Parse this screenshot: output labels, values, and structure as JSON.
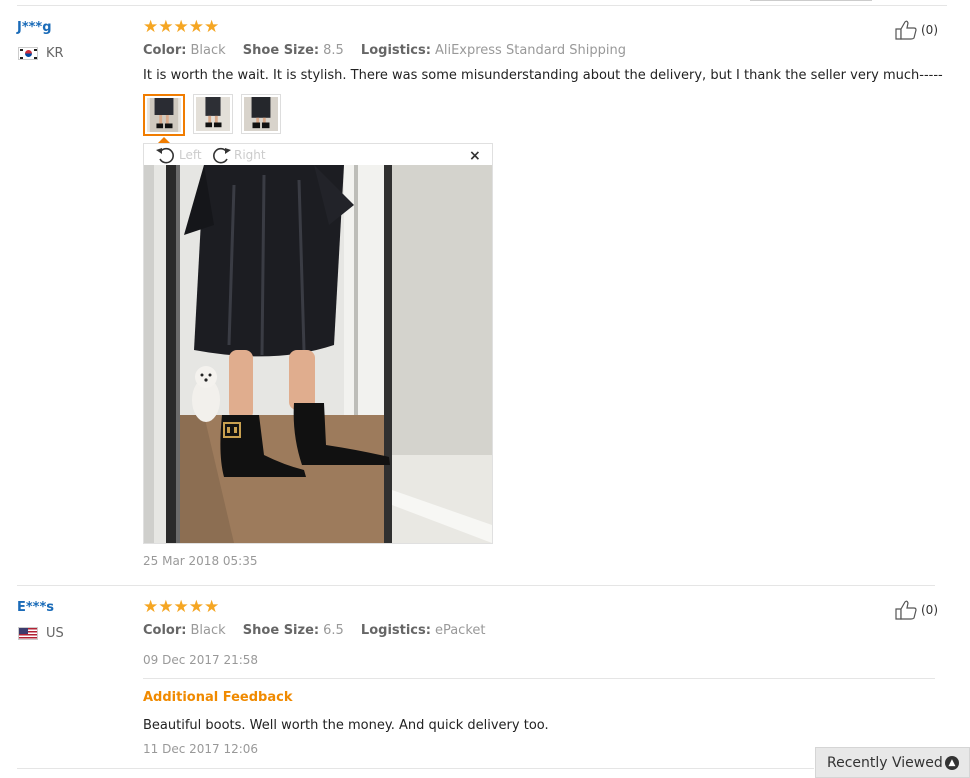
{
  "reviews": [
    {
      "user": "J***g",
      "country": "KR",
      "stars": "★★★★★",
      "rating": 5,
      "attributes": [
        {
          "label": "Color:",
          "value": "Black"
        },
        {
          "label": "Shoe Size:",
          "value": "8.5"
        },
        {
          "label": "Logistics:",
          "value": "AliExpress Standard Shipping"
        }
      ],
      "text": "It is worth the wait. It is stylish. There was some misunderstanding about the delivery, but I thank the seller very much-----",
      "helpful_count": "(0)",
      "viewer": {
        "rotate_left": "Left",
        "rotate_right": "Right",
        "close": "×"
      },
      "date": "25 Mar 2018 05:35"
    },
    {
      "user": "E***s",
      "country": "US",
      "stars": "★★★★★",
      "rating": 5,
      "attributes": [
        {
          "label": "Color:",
          "value": "Black"
        },
        {
          "label": "Shoe Size:",
          "value": "6.5"
        },
        {
          "label": "Logistics:",
          "value": "ePacket"
        }
      ],
      "helpful_count": "(0)",
      "date": "09 Dec 2017 21:58",
      "additional_title": "Additional Feedback",
      "additional_text": "Beautiful boots. Well worth the money. And quick delivery too.",
      "additional_date": "11 Dec 2017 12:06"
    }
  ],
  "recently_viewed": {
    "label": "Recently Viewed",
    "icon": "chevron-up-circle-icon"
  },
  "colors": {
    "accent": "#f07c00",
    "star": "#f5a623",
    "link": "#1a6bb8"
  }
}
